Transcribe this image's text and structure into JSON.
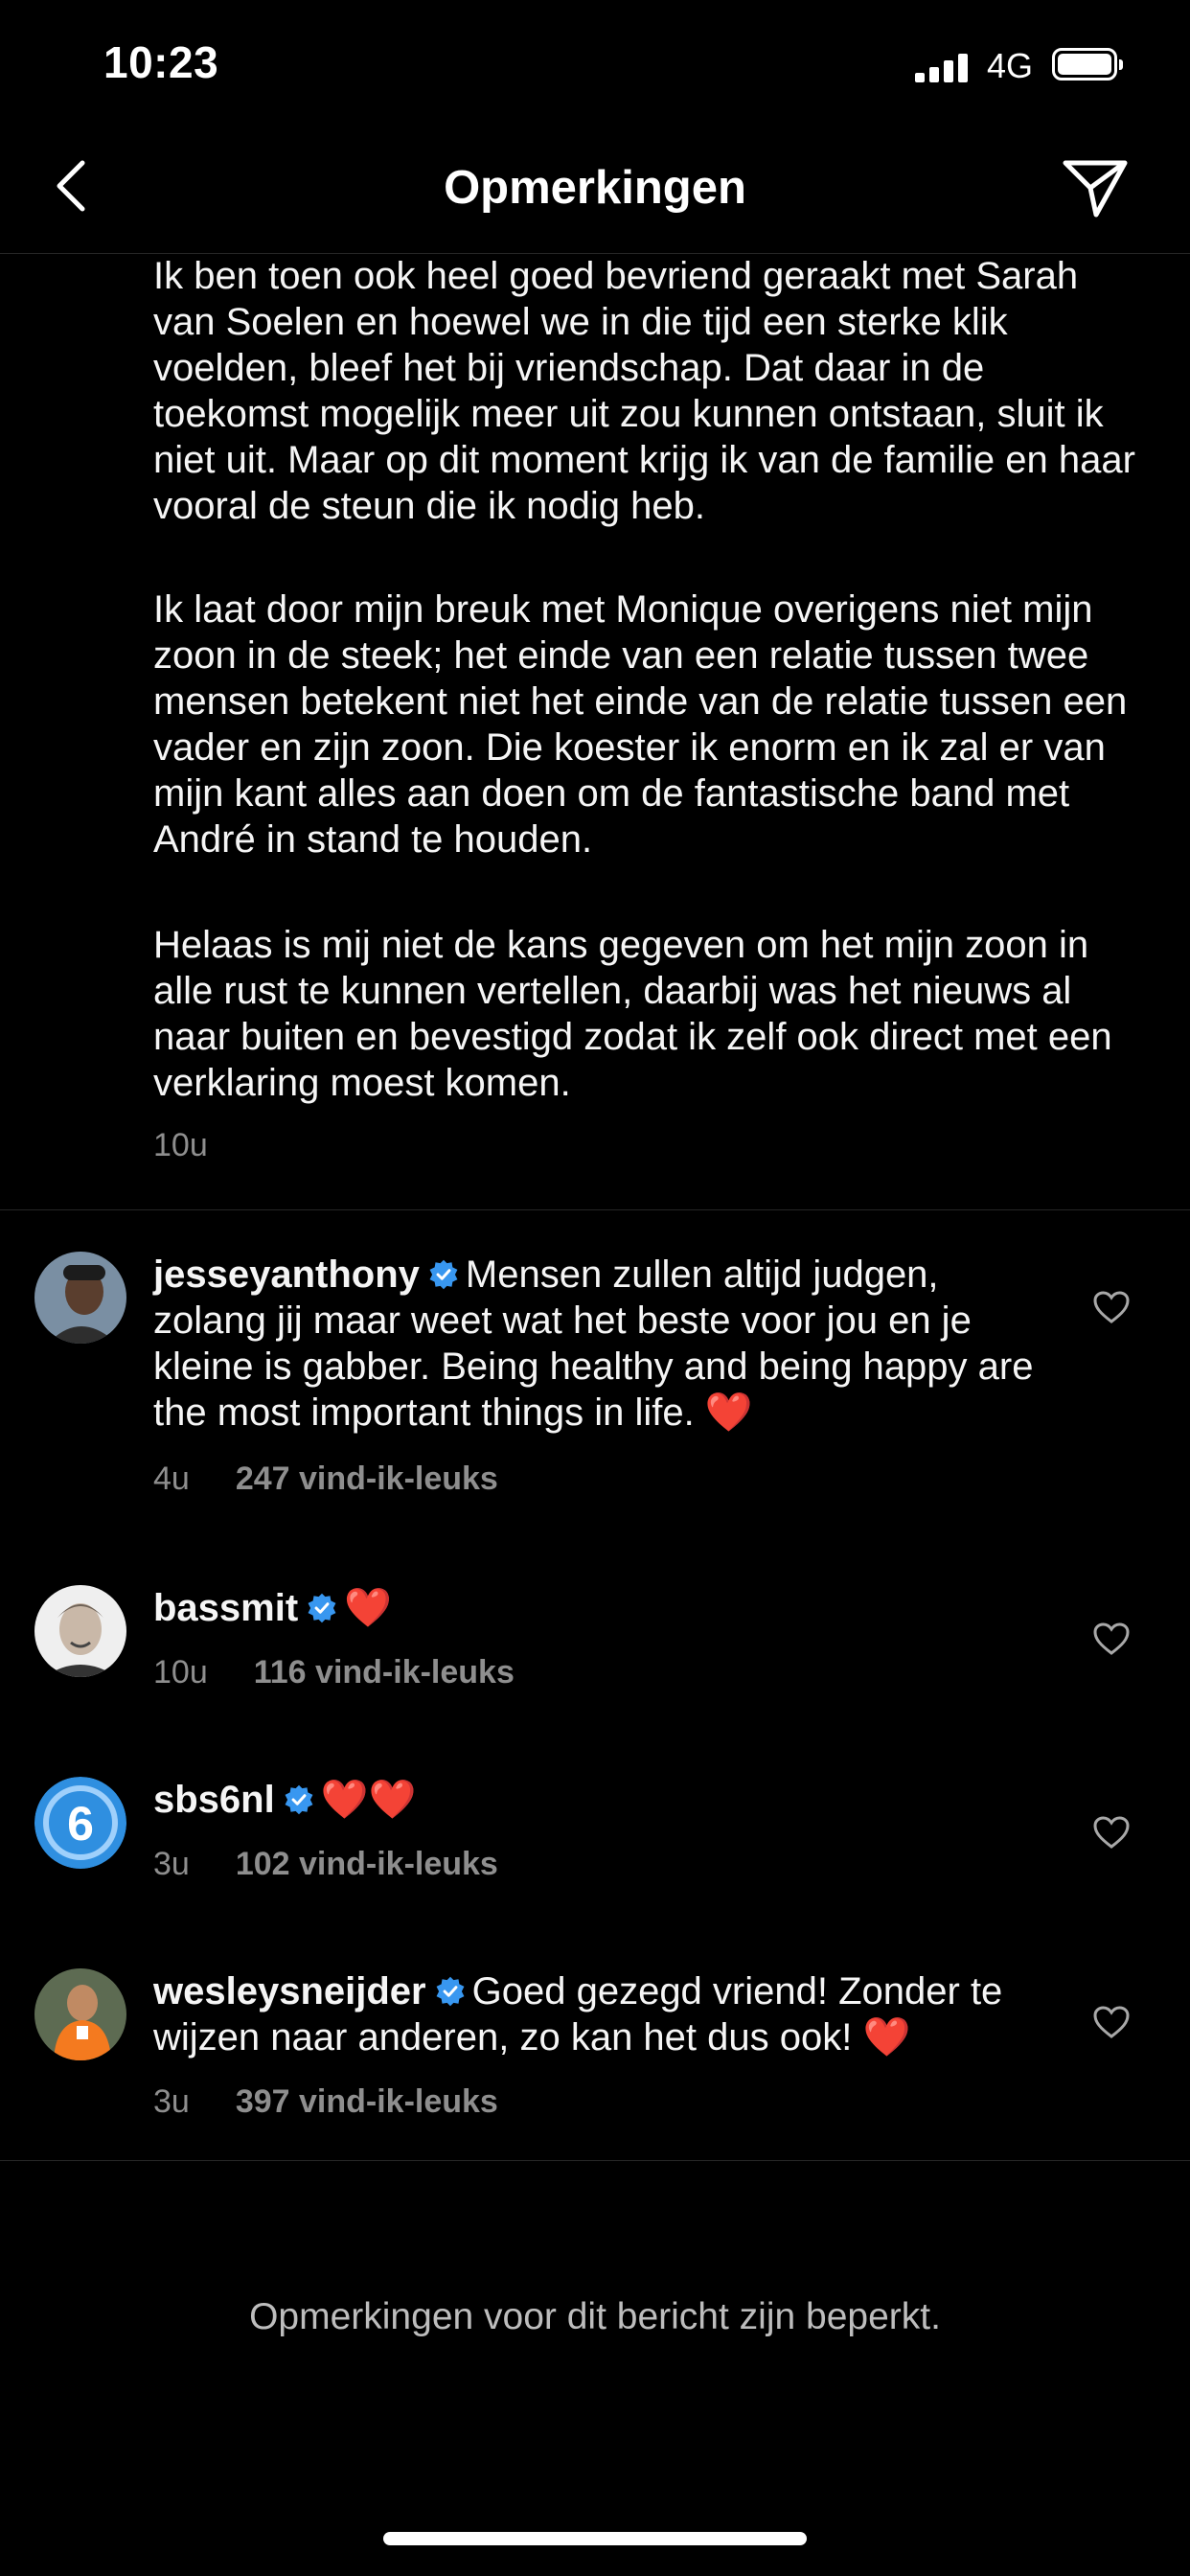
{
  "status_bar": {
    "time": "10:23",
    "network": "4G",
    "signal_icon": "cellular-signal-icon",
    "battery_icon": "battery-full-icon"
  },
  "header": {
    "title": "Opmerkingen",
    "back_icon": "chevron-left-icon",
    "share_icon": "paper-plane-icon"
  },
  "caption": {
    "paragraphs": [
      "Ik ben toen ook heel goed bevriend geraakt met Sarah van Soelen en hoewel we in die tijd een sterke klik voelden, bleef het bij vriendschap. Dat daar in de toekomst mogelijk meer uit zou kunnen ontstaan, sluit ik niet uit. Maar op dit moment krijg ik van de familie en haar vooral de steun die ik nodig heb.",
      "Ik laat door mijn breuk met Monique overigens niet mijn zoon in de steek; het einde van een relatie tussen twee mensen betekent niet het einde van de relatie tussen een vader en zijn zoon. Die koester ik enorm en ik zal er van mijn kant alles aan doen om de fantastische band met André in stand te houden.",
      "Helaas is mij niet de kans gegeven om het mijn zoon in alle rust te kunnen vertellen, daarbij was het nieuws al naar buiten en bevestigd zodat ik zelf ook direct met een verklaring moest komen."
    ],
    "time": "10u"
  },
  "comments": [
    {
      "username": "jesseyanthony",
      "text": "Mensen zullen altijd judgen, zolang jij maar weet wat het beste voor jou en je kleine is gabber. Being healthy and being happy are the most important things in life.",
      "emoji": "❤️",
      "time": "4u",
      "likes": "247 vind-ik-leuks"
    },
    {
      "username": "bassmit",
      "text": "",
      "emoji": "❤️",
      "time": "10u",
      "likes": "116 vind-ik-leuks"
    },
    {
      "username": "sbs6nl",
      "text": "",
      "emoji": "❤️❤️",
      "time": "3u",
      "likes": "102 vind-ik-leuks"
    },
    {
      "username": "wesleysneijder",
      "text": "Goed gezegd vriend! Zonder te wijzen naar anderen, zo kan het dus ook!",
      "emoji": "❤️",
      "time": "3u",
      "likes": "397 vind-ik-leuks"
    }
  ],
  "footer": {
    "restricted_notice": "Opmerkingen voor dit bericht zijn beperkt."
  },
  "colors": {
    "background": "#000000",
    "text": "#f5f5f5",
    "secondary_text": "#8e8e8e",
    "verified": "#3897f0",
    "heart": "#e0262b"
  }
}
